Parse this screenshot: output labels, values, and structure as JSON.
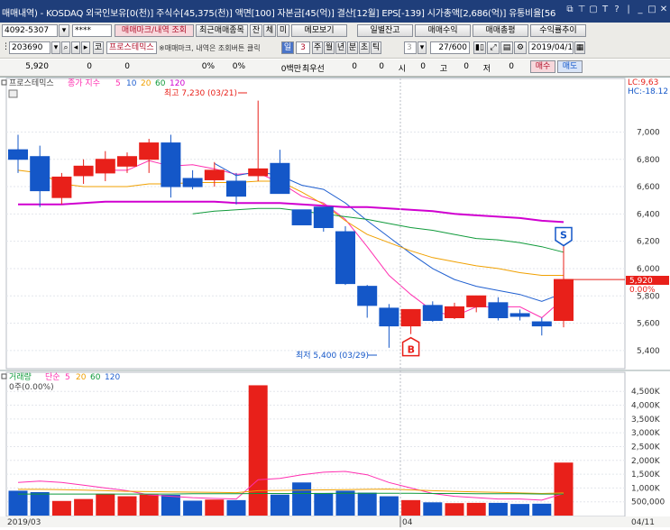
{
  "window": {
    "title": "매매내역) - KOSDAQ 외국인보유[0(천)] 주식수[45,375(천)] 액면[100] 자본금[45(억)] 결산[12월] EPS[-139] 시가총액[2,686(억)] 유통비율[56"
  },
  "toolbar1": {
    "account": "4092-5307",
    "password": "****",
    "btn_trade_mark": "매매마크/내역 조회",
    "btn_recent": "최근매매종목",
    "btn_balance_short": "잔",
    "btn_fill": "체",
    "btn_pending": "미",
    "btn_memo": "메모보기",
    "btn_daily_balance": "일별잔고",
    "btn_trade_profit": "매매수익",
    "btn_trade_total": "매매총평",
    "btn_profit_trend": "수익률추이"
  },
  "toolbar2": {
    "code": "203690",
    "stock_name": "프로스테믹스",
    "hint": "※매매마크, 내역은 조회버튼 클릭",
    "periods": [
      "일",
      "주",
      "월",
      "년",
      "분",
      "초",
      "틱"
    ],
    "period_count": "3",
    "unit_value": "3",
    "page_info": "27/600",
    "date": "2019/04/11"
  },
  "infobar": {
    "price": "5,920",
    "change": "0",
    "rate": "0",
    "pct1": "0%",
    "pct2": "0%",
    "volume": "0백만",
    "best_label": "최우선",
    "best_value": "0",
    "open_value": "0",
    "open_label": "시",
    "high_value": "0",
    "high_label": "고",
    "low_value": "0",
    "low_label": "저",
    "close_value": "0",
    "btn_buy": "매수",
    "btn_sell": "매도"
  },
  "price_panel": {
    "legend_stock": "프로스테믹스",
    "legend_label": "종가 지수",
    "ma_periods": [
      "5",
      "10",
      "20",
      "60",
      "120"
    ],
    "ma_colors": [
      "#ff2fb0",
      "#1f5fd0",
      "#f0a000",
      "#0f9a3a",
      "#d000d0"
    ],
    "lc_label": "LC:9,63",
    "hc_label": "HC:-18.12",
    "max_note": "최고 7,230 (03/21)",
    "min_note": "최저 5,400 (03/29)",
    "current_price": "5,920",
    "current_pct": "0.00%",
    "buy_marker": "B",
    "sell_marker": "S",
    "y_ticks": [
      "7,000",
      "6,800",
      "6,600",
      "6,400",
      "6,200",
      "6,000",
      "5,800",
      "5,600",
      "5,400"
    ]
  },
  "volume_panel": {
    "legend_label": "거래량",
    "legend_type": "단순",
    "ma_periods": [
      "5",
      "20",
      "60",
      "120"
    ],
    "ma_colors": [
      "#ff2fb0",
      "#f0a000",
      "#0f9a3a",
      "#1f5fd0"
    ],
    "zero_label": "0주(0.00%)",
    "y_ticks": [
      "4,500K",
      "4,000K",
      "3,500K",
      "3,000K",
      "2,500K",
      "2,000K",
      "1,500K",
      "1,000K",
      "500,000"
    ]
  },
  "x_axis": {
    "labels": [
      "2019/03",
      "04",
      "04/11"
    ]
  },
  "colors": {
    "up": "#e8201a",
    "down": "#1457c8",
    "titlebar": "#1f3e7a"
  },
  "chart_data": {
    "type": "candlestick",
    "title": "프로스테믹스",
    "ylim": [
      5300,
      7300
    ],
    "candles": [
      {
        "o": 6870,
        "h": 6980,
        "l": 6700,
        "c": 6800
      },
      {
        "o": 6820,
        "h": 6900,
        "l": 6450,
        "c": 6570
      },
      {
        "o": 6520,
        "h": 6700,
        "l": 6470,
        "c": 6670
      },
      {
        "o": 6680,
        "h": 6800,
        "l": 6620,
        "c": 6750
      },
      {
        "o": 6700,
        "h": 6860,
        "l": 6640,
        "c": 6800
      },
      {
        "o": 6750,
        "h": 6850,
        "l": 6700,
        "c": 6820
      },
      {
        "o": 6800,
        "h": 6950,
        "l": 6700,
        "c": 6920
      },
      {
        "o": 6920,
        "h": 6980,
        "l": 6520,
        "c": 6600
      },
      {
        "o": 6660,
        "h": 6720,
        "l": 6580,
        "c": 6600
      },
      {
        "o": 6650,
        "h": 6780,
        "l": 6600,
        "c": 6720
      },
      {
        "o": 6640,
        "h": 6700,
        "l": 6470,
        "c": 6530
      },
      {
        "o": 6680,
        "h": 7230,
        "l": 6640,
        "c": 6730
      },
      {
        "o": 6770,
        "h": 6870,
        "l": 6550,
        "c": 6550
      },
      {
        "o": 6430,
        "h": 6430,
        "l": 6320,
        "c": 6320
      },
      {
        "o": 6450,
        "h": 6450,
        "l": 6270,
        "c": 6300
      },
      {
        "o": 6270,
        "h": 6310,
        "l": 5880,
        "c": 5890
      },
      {
        "o": 5870,
        "h": 5880,
        "l": 5640,
        "c": 5730
      },
      {
        "o": 5710,
        "h": 5740,
        "l": 5420,
        "c": 5580
      },
      {
        "o": 5580,
        "h": 5700,
        "l": 5520,
        "c": 5700
      },
      {
        "o": 5730,
        "h": 5760,
        "l": 5610,
        "c": 5620
      },
      {
        "o": 5640,
        "h": 5750,
        "l": 5630,
        "c": 5720
      },
      {
        "o": 5720,
        "h": 5800,
        "l": 5680,
        "c": 5800
      },
      {
        "o": 5750,
        "h": 5790,
        "l": 5620,
        "c": 5640
      },
      {
        "o": 5670,
        "h": 5700,
        "l": 5620,
        "c": 5650
      },
      {
        "o": 5610,
        "h": 5640,
        "l": 5510,
        "c": 5580
      },
      {
        "o": 5620,
        "h": 6260,
        "l": 5570,
        "c": 5920
      }
    ],
    "volume": [
      900,
      850,
      530,
      600,
      790,
      700,
      760,
      750,
      540,
      580,
      560,
      4720,
      760,
      1200,
      820,
      900,
      830,
      700,
      560,
      480,
      450,
      460,
      460,
      420,
      430,
      1920
    ],
    "volume_ylim": [
      0,
      4800
    ],
    "ma_price": {
      "ma5": [
        null,
        null,
        null,
        null,
        6720,
        6720,
        6790,
        6750,
        6760,
        6730,
        6690,
        6700,
        6630,
        6530,
        6480,
        6360,
        6160,
        5950,
        5810,
        5690,
        5650,
        5720,
        5720,
        5720,
        5640,
        5780
      ],
      "ma10": [
        null,
        null,
        null,
        null,
        null,
        null,
        null,
        null,
        null,
        6770,
        6680,
        6710,
        6680,
        6610,
        6580,
        6480,
        6350,
        6230,
        6110,
        6000,
        5920,
        5870,
        5840,
        5810,
        5760,
        5820
      ],
      "ma20": [
        6720,
        6700,
        6620,
        6600,
        6600,
        6600,
        6620,
        6620,
        6630,
        6630,
        6630,
        6640,
        6640,
        6560,
        6470,
        6350,
        6250,
        6190,
        6130,
        6080,
        6050,
        6020,
        6000,
        5970,
        5950,
        5950
      ],
      "ma60": [
        null,
        null,
        null,
        null,
        null,
        null,
        null,
        null,
        6400,
        6420,
        6430,
        6440,
        6440,
        6420,
        6400,
        6380,
        6360,
        6330,
        6300,
        6280,
        6250,
        6220,
        6210,
        6190,
        6160,
        6120
      ],
      "ma120": [
        6470,
        6470,
        6470,
        6480,
        6490,
        6490,
        6490,
        6490,
        6490,
        6490,
        6480,
        6480,
        6480,
        6470,
        6460,
        6450,
        6450,
        6440,
        6430,
        6420,
        6400,
        6390,
        6380,
        6370,
        6350,
        6340
      ]
    },
    "ma_volume": {
      "ma5": [
        1200,
        1250,
        1200,
        1100,
        1000,
        900,
        750,
        700,
        650,
        620,
        600,
        1300,
        1350,
        1480,
        1570,
        1600,
        1480,
        1200,
        1000,
        800,
        700,
        650,
        600,
        600,
        560,
        800
      ],
      "ma20": [
        950,
        950,
        940,
        920,
        900,
        880,
        870,
        860,
        850,
        840,
        830,
        900,
        910,
        920,
        930,
        940,
        950,
        960,
        930,
        900,
        880,
        860,
        840,
        820,
        800,
        820
      ],
      "ma60": [
        780,
        780,
        780,
        780,
        780,
        780,
        780,
        780,
        790,
        790,
        790,
        800,
        800,
        800,
        800,
        810,
        810,
        810,
        810,
        800,
        800,
        790,
        790,
        790,
        780,
        780
      ]
    },
    "buy_marker_index": 18,
    "sell_marker_index": 25
  }
}
